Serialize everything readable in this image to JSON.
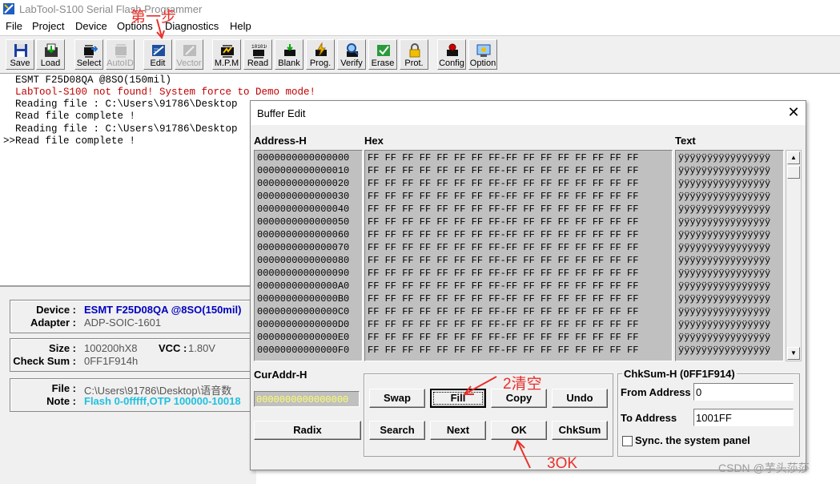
{
  "app": {
    "title": "LabTool-S100 Serial Flash Programmer",
    "menu": [
      "File",
      "Project",
      "Device",
      "Options",
      "Diagnostics",
      "Help"
    ]
  },
  "toolbar": [
    {
      "label": "Save",
      "icon": "floppy-icon",
      "disabled": false
    },
    {
      "label": "Load",
      "icon": "folder-load-icon",
      "disabled": false
    },
    {
      "label": "Select",
      "icon": "select-device-icon",
      "disabled": false
    },
    {
      "label": "AutoID",
      "icon": "autoid-icon",
      "disabled": true
    },
    {
      "label": "Edit",
      "icon": "edit-icon",
      "disabled": false
    },
    {
      "label": "Vector",
      "icon": "vector-icon",
      "disabled": true
    },
    {
      "label": "M.P.M",
      "icon": "mpm-icon",
      "disabled": false
    },
    {
      "label": "Read",
      "icon": "read-icon",
      "disabled": false
    },
    {
      "label": "Blank",
      "icon": "blank-icon",
      "disabled": false
    },
    {
      "label": "Prog.",
      "icon": "program-icon",
      "disabled": false
    },
    {
      "label": "Verify",
      "icon": "verify-icon",
      "disabled": false
    },
    {
      "label": "Erase",
      "icon": "erase-icon",
      "disabled": false
    },
    {
      "label": "Prot.",
      "icon": "lock-icon",
      "disabled": false
    },
    {
      "label": "Config",
      "icon": "config-icon",
      "disabled": false
    },
    {
      "label": "Option",
      "icon": "option-icon",
      "disabled": false
    }
  ],
  "log": [
    {
      "text": "  ESMT F25D08QA @8SO(150mil)",
      "color": "#000000"
    },
    {
      "text": "  LabTool-S100 not found! System force to Demo mode!",
      "color": "#c00000"
    },
    {
      "text": "  Reading file : C:\\Users\\91786\\Desktop",
      "color": "#000000"
    },
    {
      "text": "  Read file complete !",
      "color": "#000000"
    },
    {
      "text": "  Reading file : C:\\Users\\91786\\Desktop",
      "color": "#000000"
    },
    {
      "text": ">>Read file complete !",
      "color": "#000000"
    }
  ],
  "info": {
    "device_key": "Device :",
    "device_val": "ESMT F25D08QA @8SO(150mil)",
    "adapter_key": "Adapter :",
    "adapter_val": "ADP-SOIC-1601",
    "size_key": "Size :",
    "size_val": "100200hX8",
    "vcc_key": "VCC :",
    "vcc_val": "1.80V",
    "checksum_key": "Check Sum :",
    "checksum_val": "0FF1F914h",
    "file_key": "File :",
    "file_val": "C:\\Users\\91786\\Desktop\\语音数",
    "note_key": "Note :",
    "note_val": "Flash 0-0fffff,OTP 100000-10018"
  },
  "dialog": {
    "title": "Buffer Edit",
    "close": "✕",
    "col_address": "Address-H",
    "col_hex": "Hex",
    "col_text": "Text",
    "addresses": [
      "0000000000000000",
      "0000000000000010",
      "0000000000000020",
      "0000000000000030",
      "0000000000000040",
      "0000000000000050",
      "0000000000000060",
      "0000000000000070",
      "0000000000000080",
      "0000000000000090",
      "00000000000000A0",
      "00000000000000B0",
      "00000000000000C0",
      "00000000000000D0",
      "00000000000000E0",
      "00000000000000F0"
    ],
    "hex_row": "FF FF FF FF FF FF FF FF-FF FF FF FF FF FF FF FF",
    "text_row": "ÿÿÿÿÿÿÿÿÿÿÿÿÿÿÿÿ",
    "curaddr_label": "CurAddr-H",
    "curaddr_value": "0000000000000000",
    "buttons": {
      "radix": "Radix",
      "swap": "Swap",
      "fill": "Fill",
      "copy": "Copy",
      "undo": "Undo",
      "search": "Search",
      "next": "Next",
      "ok": "OK",
      "chksum": "ChkSum"
    },
    "chksum_title": "ChkSum-H (0FF1F914)",
    "from_label": "From Address",
    "from_value": "0",
    "to_label": "To Address",
    "to_value": "1001FF",
    "sync_label": "Sync. the system panel"
  },
  "annotations": {
    "step1": "第一步",
    "step2": "2清空",
    "step3": "3OK"
  },
  "watermark": "CSDN @芋头莎莎"
}
